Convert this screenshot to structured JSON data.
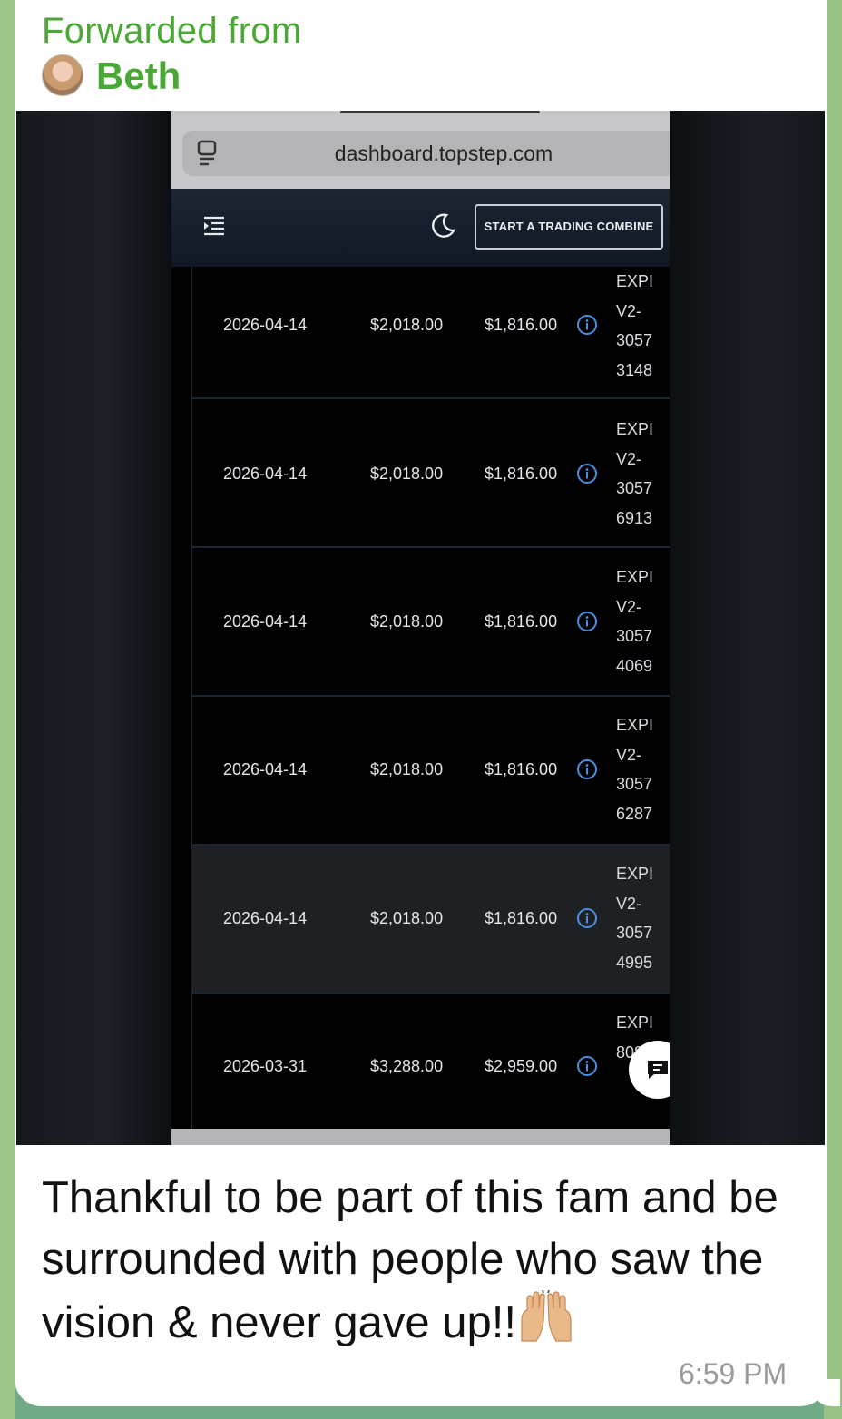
{
  "message": {
    "forwarded_label": "Forwarded from",
    "sender_name": "Beth",
    "caption": "Thankful to be part of this fam and be surrounded with people who saw the vision & never gave up!!",
    "emoji_icon": "raising-hands-icon",
    "time": "6:59 PM"
  },
  "screenshot": {
    "url": "dashboard.topstep.com",
    "cta_label": "START A TRADING COMBINE",
    "rows": [
      {
        "date": "2026-04-14",
        "amount": "$2,018.00",
        "net": "$1,816.00",
        "desc": [
          "EXPI",
          "V2-",
          "3057",
          "3148"
        ]
      },
      {
        "date": "2026-04-14",
        "amount": "$2,018.00",
        "net": "$1,816.00",
        "desc": [
          "EXPI",
          "V2-",
          "3057",
          "6913"
        ]
      },
      {
        "date": "2026-04-14",
        "amount": "$2,018.00",
        "net": "$1,816.00",
        "desc": [
          "EXPI",
          "V2-",
          "3057",
          "4069"
        ]
      },
      {
        "date": "2026-04-14",
        "amount": "$2,018.00",
        "net": "$1,816.00",
        "desc": [
          "EXPI",
          "V2-",
          "3057",
          "6287"
        ]
      },
      {
        "date": "2026-04-14",
        "amount": "$2,018.00",
        "net": "$1,816.00",
        "desc": [
          "EXPI",
          "V2-",
          "3057",
          "4995"
        ]
      },
      {
        "date": "2026-03-31",
        "amount": "$3,288.00",
        "net": "$2,959.00",
        "desc": [
          "EXPI",
          "",
          "",
          "8086"
        ]
      }
    ]
  },
  "colors": {
    "forward_green": "#4aa934",
    "info_blue": "#4a90e2"
  }
}
